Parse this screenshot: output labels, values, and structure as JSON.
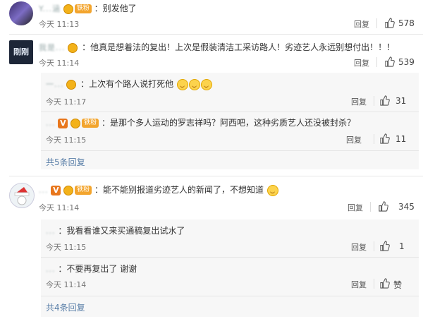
{
  "comments": [
    {
      "name": "Y...涵",
      "badge": "铁粉",
      "text": "：别发他了",
      "time": "今天 11:13",
      "reply_label": "回复",
      "likes": "578"
    },
    {
      "name": "我是...",
      "badge": "",
      "text": "：他真是想着法的复出！上次是假装清洁工采访路人！劣迹艺人永远别想付出！！！",
      "time": "今天 11:14",
      "reply_label": "回复",
      "likes": "539",
      "avatar_text": "刚刚",
      "replies": [
        {
          "name": "一...",
          "badge": "",
          "text": "：上次有个路人说打死他",
          "time": "今天 11:17",
          "reply_label": "回复",
          "likes": "31"
        },
        {
          "name": "...",
          "badge": "铁粉",
          "v": "V",
          "text": "：是那个多人运动的罗志祥吗？阿西吧，这种劣质艺人还没被封杀？",
          "time": "今天 11:15",
          "reply_label": "回复",
          "likes": "11"
        }
      ],
      "more": "共5条回复"
    },
    {
      "name": "...",
      "badge": "铁粉",
      "v": "V",
      "text": "：能不能别报道劣迹艺人的新闻了，不想知道",
      "time": "今天 11:14",
      "reply_label": "回复",
      "likes": "345",
      "replies": [
        {
          "name": "...",
          "badge": "",
          "text": "：我看看谁又来买通稿复出试水了",
          "time": "今天 11:15",
          "reply_label": "回复",
          "likes": "1"
        },
        {
          "name": "...",
          "badge": "",
          "text": "：不要再复出了 谢谢",
          "time": "今天 11:14",
          "reply_label": "回复",
          "likes": "赞"
        }
      ],
      "more": "共4条回复"
    }
  ],
  "colors": {
    "badge": "#f3a52e",
    "link": "#5a7fa8",
    "reply_bg": "#f7f7f7"
  },
  "icons": {
    "like": "thumbs-up-icon"
  }
}
